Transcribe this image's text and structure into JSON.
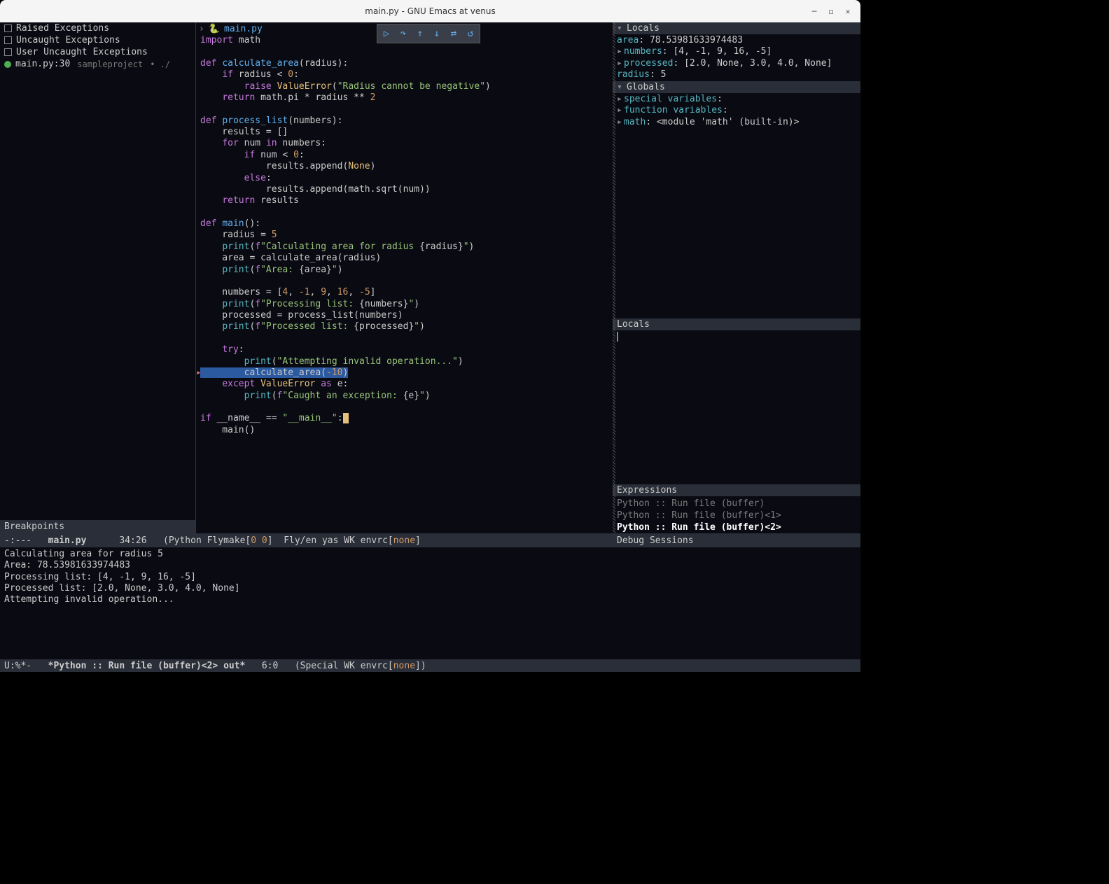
{
  "window": {
    "title": "main.py - GNU Emacs at venus"
  },
  "left": {
    "items": [
      {
        "type": "check",
        "label": "Raised Exceptions"
      },
      {
        "type": "check",
        "label": "Uncaught Exceptions"
      },
      {
        "type": "check",
        "label": "User Uncaught Exceptions"
      }
    ],
    "breakpoint": {
      "loc": "main.py:30",
      "proj": "sampleproject",
      "path": "• ./"
    },
    "footer": "Breakpoints"
  },
  "editor": {
    "filename": "main.py",
    "toolbar_icons": [
      "continue-icon",
      "step-over-icon",
      "step-out-icon",
      "step-in-icon",
      "detach-icon",
      "restart-icon"
    ]
  },
  "right": {
    "locals_head": "Locals",
    "locals": [
      {
        "name": "area",
        "value": "78.53981633974483",
        "leaf": true
      },
      {
        "name": "numbers",
        "value": "[4, -1, 9, 16, -5]",
        "leaf": false
      },
      {
        "name": "processed",
        "value": "[2.0, None, 3.0, 4.0, None]",
        "leaf": false
      },
      {
        "name": "radius",
        "value": "5",
        "leaf": true
      }
    ],
    "globals_head": "Globals",
    "globals": [
      {
        "name": "special variables",
        "value": "",
        "leaf": false
      },
      {
        "name": "function variables",
        "value": "",
        "leaf": false
      },
      {
        "name": "math",
        "value": "<module 'math' (built-in)>",
        "leaf": false
      }
    ],
    "locals2_head": "Locals",
    "expr_head": "Expressions",
    "sessions": [
      {
        "label": "Python :: Run file (buffer)",
        "active": false
      },
      {
        "label": "Python :: Run file (buffer)<1>",
        "active": false
      },
      {
        "label": "Python :: Run file (buffer)<2>",
        "active": true
      }
    ],
    "sessions_head": "Debug Sessions"
  },
  "modeline1": {
    "left": "-:---   ",
    "file": "main.py",
    "pos": "      34:26   (Python Flymake[",
    "zero1": "0",
    "sep": " ",
    "zero2": "0",
    "mid": "]  Fly/en yas WK envrc[",
    "none": "none",
    "end": "]"
  },
  "modeline2": {
    "prefix": "U:%*-   ",
    "buf": "*Python :: Run file (buffer)<2> out*",
    "pos": "   6:0   (Special WK envrc[",
    "none": "none",
    "end": "])"
  },
  "output_lines": [
    "Calculating area for radius 5",
    "Area: 78.53981633974483",
    "Processing list: [4, -1, 9, 16, -5]",
    "Processed list: [2.0, None, 3.0, 4.0, None]",
    "Attempting invalid operation..."
  ]
}
